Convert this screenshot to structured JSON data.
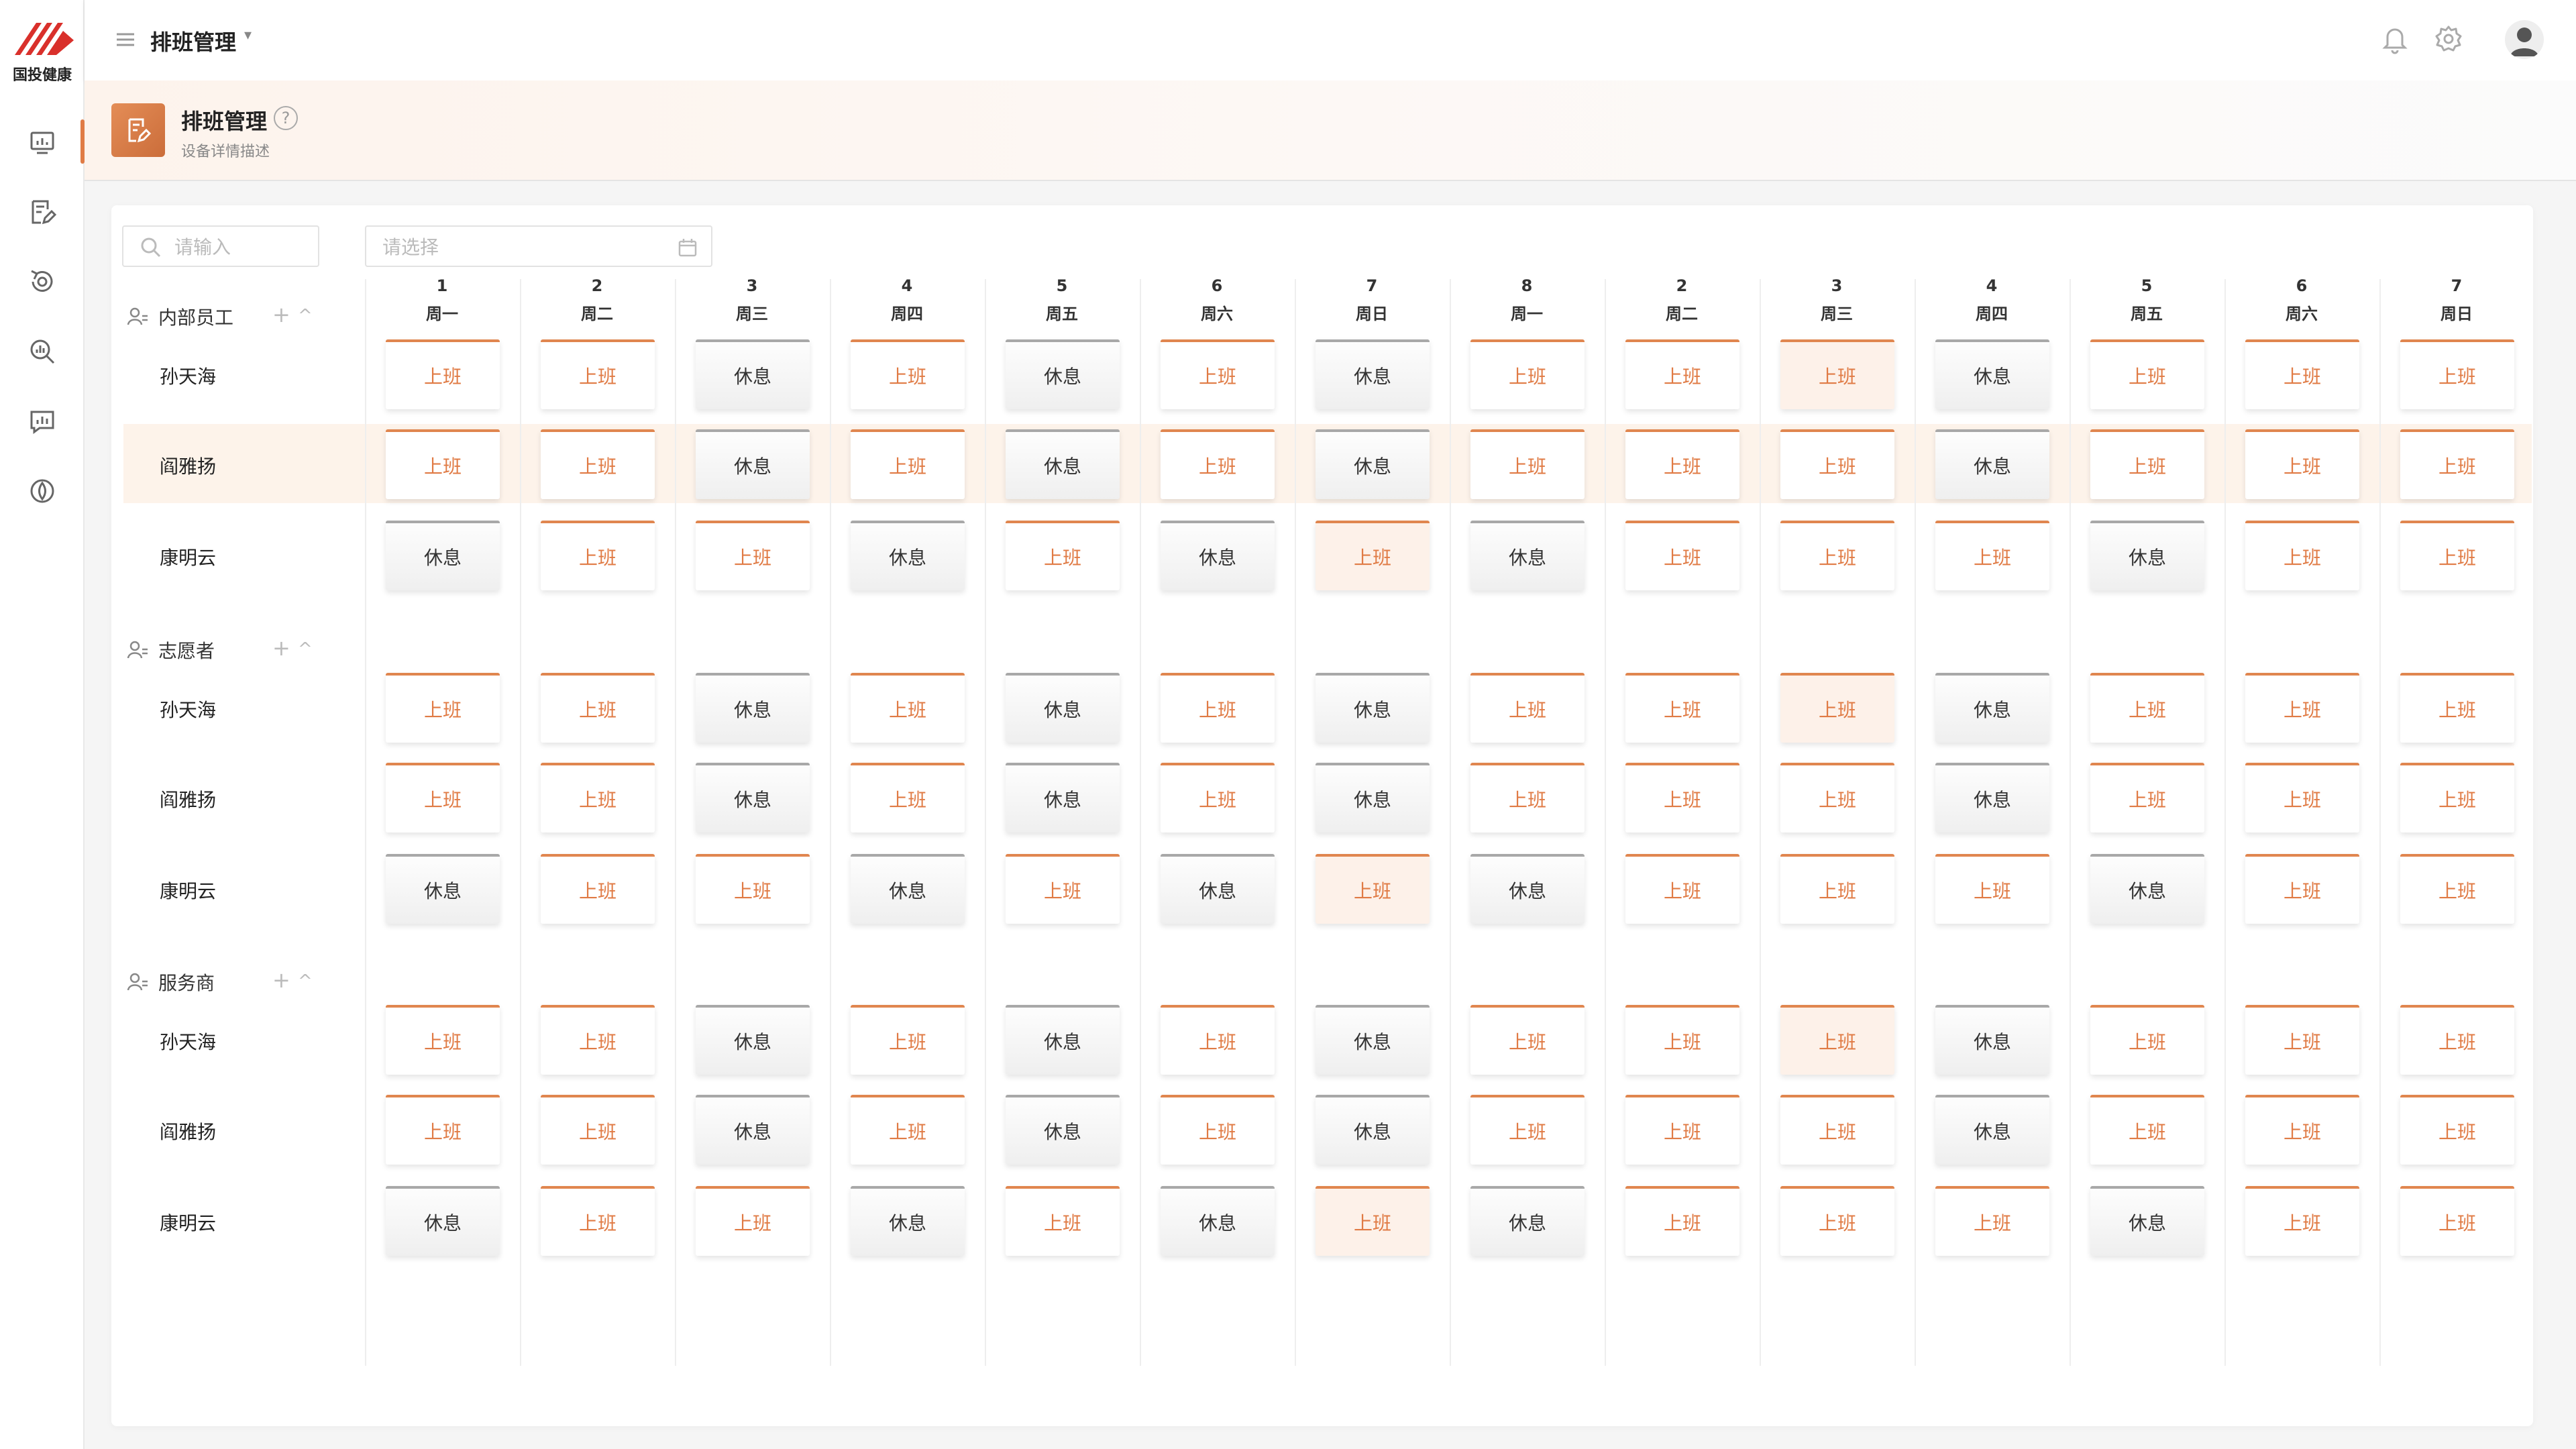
{
  "brand": {
    "logo_text": "国投健康",
    "accent": "#e07b45"
  },
  "topbar": {
    "title": "排班管理",
    "icons": [
      "bell-icon",
      "gear-icon",
      "user-avatar-icon"
    ]
  },
  "page_header": {
    "title": "排班管理",
    "subtitle": "设备详情描述",
    "help": "?"
  },
  "sidebar": {
    "items": [
      {
        "icon": "monitor-chart-icon"
      },
      {
        "icon": "document-edit-icon"
      },
      {
        "icon": "refresh-target-icon"
      },
      {
        "icon": "search-chart-icon"
      },
      {
        "icon": "message-chart-icon"
      },
      {
        "icon": "compass-icon"
      }
    ]
  },
  "filters": {
    "search_placeholder": "请输入",
    "date_placeholder": "请选择"
  },
  "days": [
    {
      "num": "1",
      "week": "周一"
    },
    {
      "num": "2",
      "week": "周二"
    },
    {
      "num": "3",
      "week": "周三"
    },
    {
      "num": "4",
      "week": "周四"
    },
    {
      "num": "5",
      "week": "周五"
    },
    {
      "num": "6",
      "week": "周六"
    },
    {
      "num": "7",
      "week": "周日"
    },
    {
      "num": "8",
      "week": "周一"
    },
    {
      "num": "2",
      "week": "周二"
    },
    {
      "num": "3",
      "week": "周三"
    },
    {
      "num": "4",
      "week": "周四"
    },
    {
      "num": "5",
      "week": "周五"
    },
    {
      "num": "6",
      "week": "周六"
    },
    {
      "num": "7",
      "week": "周日"
    }
  ],
  "labels": {
    "work": "上班",
    "rest": "休息",
    "add": "+",
    "collapse": "^"
  },
  "groups": [
    {
      "name": "内部员工",
      "people": [
        {
          "name": "孙天海",
          "highlighted": false,
          "shifts": [
            "W",
            "W",
            "R",
            "W",
            "R",
            "W",
            "R",
            "W",
            "W",
            "W2",
            "R",
            "W",
            "W",
            "W"
          ]
        },
        {
          "name": "阎雅扬",
          "highlighted": true,
          "shifts": [
            "W",
            "W",
            "R",
            "W",
            "R",
            "W",
            "R",
            "W",
            "W",
            "W",
            "R",
            "W",
            "W",
            "W"
          ]
        },
        {
          "name": "康明云",
          "highlighted": false,
          "shifts": [
            "R",
            "W",
            "W",
            "R",
            "W",
            "R",
            "W2",
            "R",
            "W",
            "W",
            "W",
            "R",
            "W",
            "W"
          ]
        }
      ]
    },
    {
      "name": "志愿者",
      "people": [
        {
          "name": "孙天海",
          "highlighted": false,
          "shifts": [
            "W",
            "W",
            "R",
            "W",
            "R",
            "W",
            "R",
            "W",
            "W",
            "W2",
            "R",
            "W",
            "W",
            "W"
          ]
        },
        {
          "name": "阎雅扬",
          "highlighted": false,
          "shifts": [
            "W",
            "W",
            "R",
            "W",
            "R",
            "W",
            "R",
            "W",
            "W",
            "W",
            "R",
            "W",
            "W",
            "W"
          ]
        },
        {
          "name": "康明云",
          "highlighted": false,
          "shifts": [
            "R",
            "W",
            "W",
            "R",
            "W",
            "R",
            "W2",
            "R",
            "W",
            "W",
            "W",
            "R",
            "W",
            "W"
          ]
        }
      ]
    },
    {
      "name": "服务商",
      "people": [
        {
          "name": "孙天海",
          "highlighted": false,
          "shifts": [
            "W",
            "W",
            "R",
            "W",
            "R",
            "W",
            "R",
            "W",
            "W",
            "W2",
            "R",
            "W",
            "W",
            "W"
          ]
        },
        {
          "name": "阎雅扬",
          "highlighted": false,
          "shifts": [
            "W",
            "W",
            "R",
            "W",
            "R",
            "W",
            "R",
            "W",
            "W",
            "W",
            "R",
            "W",
            "W",
            "W"
          ]
        },
        {
          "name": "康明云",
          "highlighted": false,
          "shifts": [
            "R",
            "W",
            "W",
            "R",
            "W",
            "R",
            "W2",
            "R",
            "W",
            "W",
            "W",
            "R",
            "W",
            "W"
          ]
        }
      ]
    }
  ]
}
